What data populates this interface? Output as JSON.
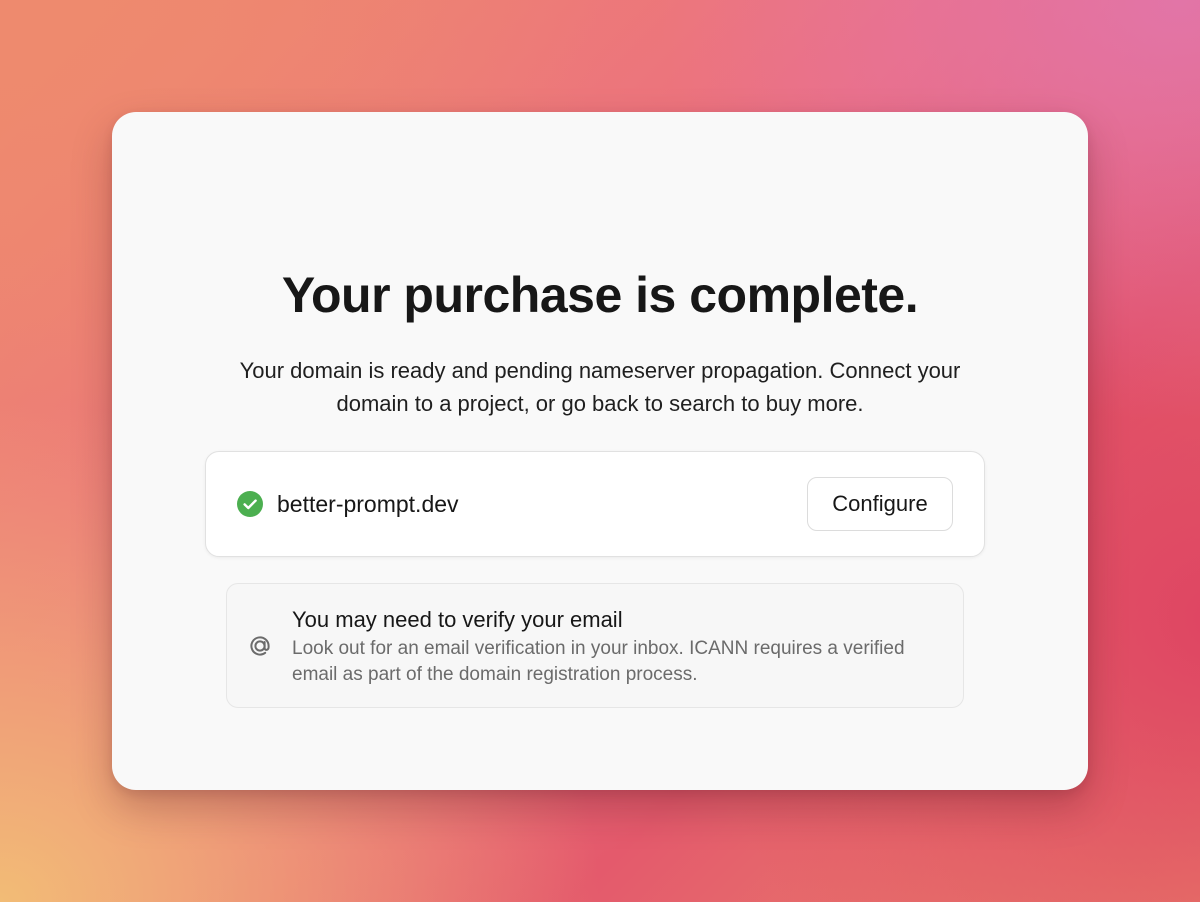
{
  "page": {
    "title": "Your purchase is complete.",
    "subtitle": "Your domain is ready and pending nameserver propagation. Connect your domain to a project, or go back to search to buy more."
  },
  "domain": {
    "name": "better-prompt.dev",
    "status_icon": "check-circle-icon",
    "status_color": "#4caf50",
    "configure_label": "Configure"
  },
  "notice": {
    "icon": "at-sign-icon",
    "title": "You may need to verify your email",
    "body": "Look out for an email verification in your inbox. ICANN requires a verified email as part of the domain registration process."
  },
  "colors": {
    "card_background": "#f9f9f9",
    "text_primary": "#171717",
    "text_secondary": "#6b6b6b"
  }
}
